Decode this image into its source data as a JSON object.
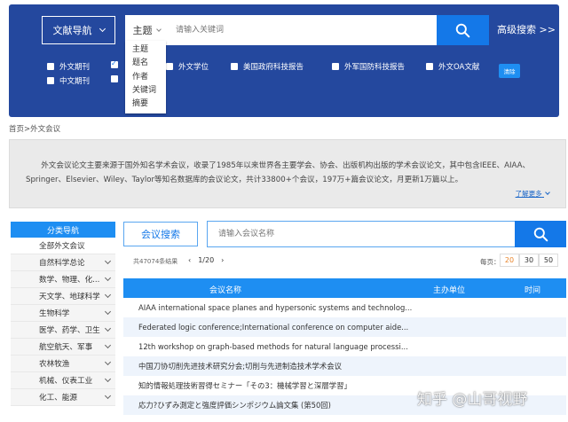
{
  "header": {
    "nav_label": "文献导航",
    "search": {
      "field": "主题",
      "placeholder": "请输入关键词",
      "field_options": [
        "主题",
        "题名",
        "作者",
        "关键词",
        "摘要"
      ]
    },
    "advanced_label": "高级搜索 >>",
    "clear_label": "清除",
    "checkboxes": [
      {
        "label": "外文期刊",
        "checked": false
      },
      {
        "label": "外文学位",
        "checked": false
      },
      {
        "label": "美国政府科技报告",
        "checked": false
      },
      {
        "label": "外军国防科技报告",
        "checked": false
      },
      {
        "label": "外文OA文献",
        "checked": false
      },
      {
        "label": "中文期刊",
        "checked": false
      }
    ]
  },
  "breadcrumb": "首页>外文会议",
  "intro": {
    "text": "外文会议论文主要来源于国外知名学术会议，收录了1985年以来世界各主要学会、协会、出版机构出版的学术会议论文，其中包含IEEE、AIAA、Springer、Elsevier、Wiley、Taylor等知名数据库的会议论文，共计33800+个会议，197万+篇会议论文，月更新1万篇以上。",
    "more_label": "了解更多"
  },
  "sidebar": {
    "title": "分类导航",
    "items": [
      "全部外文会议",
      "自然科学总论",
      "数学、物理、化...",
      "天文学、地球科学",
      "生物科学",
      "医学、药学、卫生",
      "航空航天、军事",
      "农林牧渔",
      "机械、仪表工业",
      "化工、能源"
    ]
  },
  "conf_search": {
    "tab_label": "会议搜索",
    "placeholder": "请输入会议名称"
  },
  "results": {
    "total": "共47074条结果",
    "page": "1/20",
    "per_page_label": "每页：",
    "per_page_options": [
      "20",
      "30",
      "50"
    ],
    "per_page_selected": "20"
  },
  "table": {
    "headers": [
      "会议名称",
      "主办单位",
      "时间"
    ],
    "rows": [
      "AIAA international space planes and hypersonic systems and technolog...",
      "Federated logic conference;International conference on computer aide...",
      "12th workshop on graph-based methods for natural language processi...",
      "中国刀协切削先进技术研究分会;切削与先进制造技术学术会议",
      "知的情報処理技術習得セミナー「その3：機械学習と深層学習」",
      "応力?ひずみ測定と強度評価シンポジウム論文集 (第50回)"
    ]
  },
  "watermark": "知乎 @山哥视野",
  "colors": {
    "header_bg": "#24489e",
    "accent": "#1478e8",
    "table_header": "#1e8ef2"
  }
}
